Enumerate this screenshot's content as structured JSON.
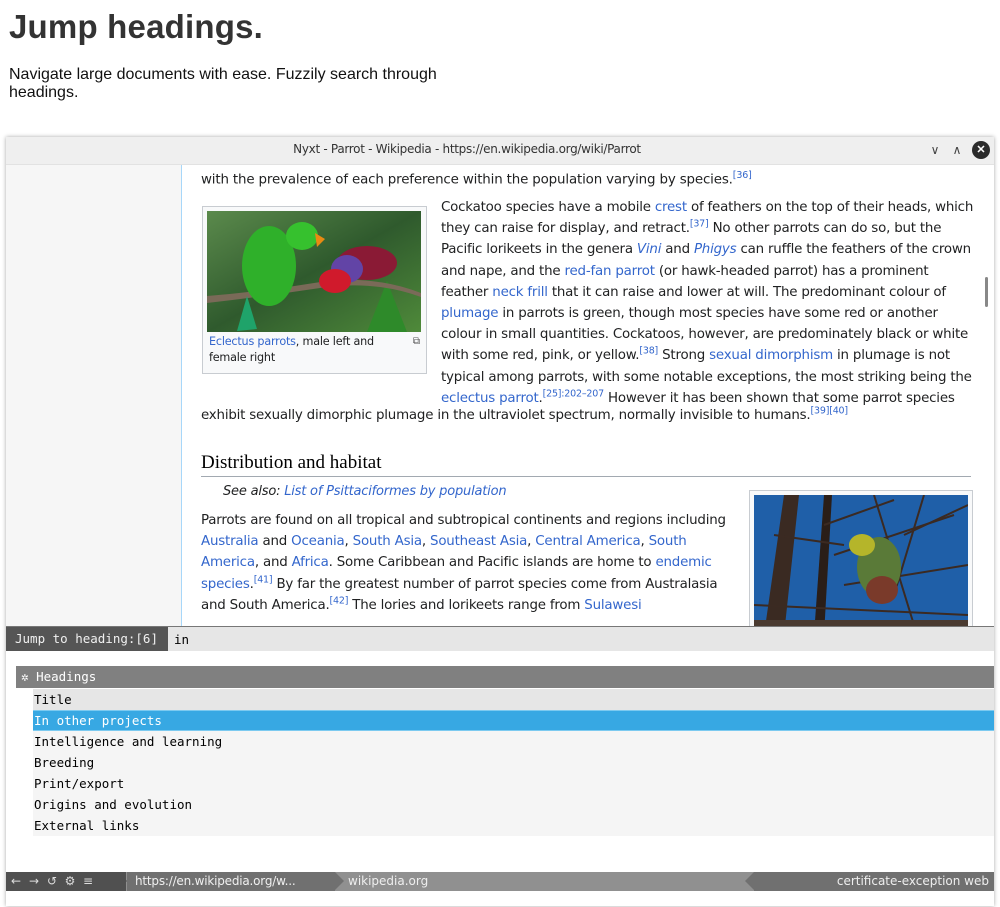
{
  "hero": {
    "title": "Jump headings.",
    "description": "Navigate large documents with ease. Fuzzily search through headings."
  },
  "window": {
    "title": "Nyxt - Parrot - Wikipedia - https://en.wikipedia.org/wiki/Parrot",
    "controls": {
      "minimize": "∨",
      "maximize": "∧",
      "close": "✕"
    }
  },
  "article": {
    "p1": {
      "text": "with the prevalence of each preference within the population varying by species.",
      "ref": "[36]"
    },
    "figure1": {
      "caption_link": "Eclectus parrots",
      "caption_rest": ", male left and female right",
      "enlarge_icon": "⧉"
    },
    "p2": {
      "t1": "Cockatoo species have a mobile ",
      "l1": "crest",
      "t2": " of feathers on the top of their heads, which they can raise for display, and retract.",
      "r1": "[37]",
      "t3": " No other parrots can do so, but the Pacific lorikeets in the genera ",
      "l2": "Vini",
      "t4": " and ",
      "l3": "Phigys",
      "t5": " can ruffle the feathers of the crown and nape, and the ",
      "l4": "red-fan parrot",
      "t6": " (or hawk-headed parrot) has a prominent feather ",
      "l5": "neck frill",
      "t7": " that it can raise and lower at will. The predominant colour of ",
      "l6": "plumage",
      "t8": " in parrots is green, though most species have some red or another colour in small quantities. Cockatoos, however, are predominately black or white with some red, pink, or yellow.",
      "r2": "[38]",
      "t9": " Strong ",
      "l7": "sexual dimorphism",
      "t10": " in plumage is not typical among parrots, with some notable exceptions, the most striking being the ",
      "l8": "eclectus parrot",
      "t11": ".",
      "r3": "[25]:202–207",
      "t12": " However it has been shown that some parrot species"
    },
    "p3": {
      "text": "exhibit sexually dimorphic plumage in the ultraviolet spectrum, normally invisible to humans.",
      "ref": "[39][40]"
    },
    "section_heading": "Distribution and habitat",
    "see_also": {
      "label": "See also: ",
      "link": "List of Psittaciformes by population"
    },
    "p4": {
      "t1": "Parrots are found on all tropical and subtropical continents and regions including ",
      "l1": "Australia",
      "t2": " and ",
      "l2": "Oceania",
      "t3": ", ",
      "l3": "South Asia",
      "t4": ", ",
      "l4": "Southeast Asia",
      "t5": ", ",
      "l5": "Central America",
      "t6": ", ",
      "l6": "South America",
      "t7": ", and ",
      "l7": "Africa",
      "t8": ". Some Caribbean and Pacific islands are home to ",
      "l8": "endemic species",
      "t9": ".",
      "r1": "[41]",
      "t10": " By far the greatest number of parrot species come from Australasia and South America.",
      "r2": "[42]",
      "t11": " The lories and lorikeets range from ",
      "l9": "Sulawesi"
    }
  },
  "prompt": {
    "label": "Jump to heading:[6]",
    "input_value": "in"
  },
  "results": {
    "source_icon": "✲",
    "source_name": "Headings",
    "items": [
      {
        "label": "Title"
      },
      {
        "label": "In other projects",
        "selected": true
      },
      {
        "label": "Intelligence and learning"
      },
      {
        "label": "Breeding"
      },
      {
        "label": "Print/export"
      },
      {
        "label": "Origins and evolution"
      },
      {
        "label": "External links"
      }
    ]
  },
  "statusbar": {
    "back": "←",
    "forward": "→",
    "reload": "↺",
    "settings": "⚙",
    "menu": "≡",
    "url": "https://en.wikipedia.org/w...",
    "domain": "wikipedia.org",
    "modes": "certificate-exception web"
  }
}
